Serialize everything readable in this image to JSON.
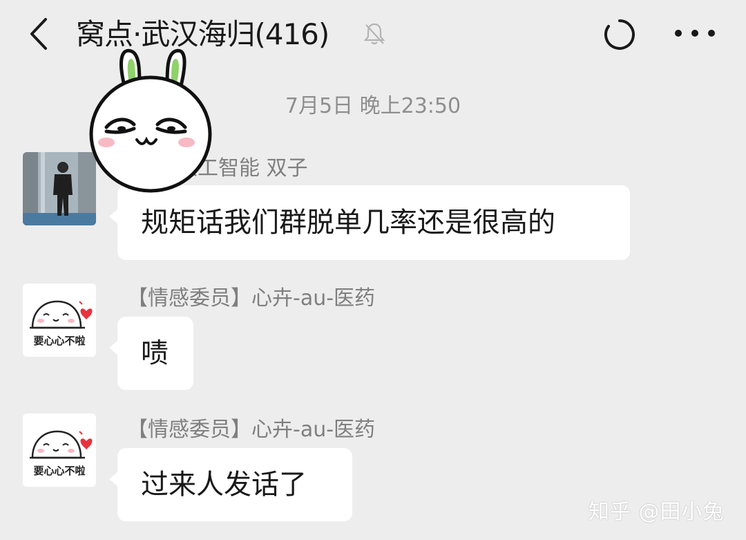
{
  "header": {
    "title": "窝点·武汉海归(416)",
    "icons": [
      "back-icon",
      "mute-icon",
      "loading-icon",
      "more-icon"
    ]
  },
  "timestamp": "7月5日 晚上23:50",
  "messages": [
    {
      "sender": "人工智能 双子",
      "text": "规矩话我们群脱单几率还是很高的",
      "avatar": "photo"
    },
    {
      "sender": "【情感委员】心卉-au-医药",
      "text": "啧",
      "avatar": "sticker"
    },
    {
      "sender": "【情感委员】心卉-au-医药",
      "text": "过来人发话了",
      "avatar": "sticker"
    }
  ],
  "avatar_sticker_caption": "要心心不啦",
  "watermark": "知乎 @田小兔",
  "colors": {
    "background": "#ededed",
    "bubble": "#ffffff",
    "meta_text": "#8e8e8e",
    "heart": "#e8323c"
  }
}
